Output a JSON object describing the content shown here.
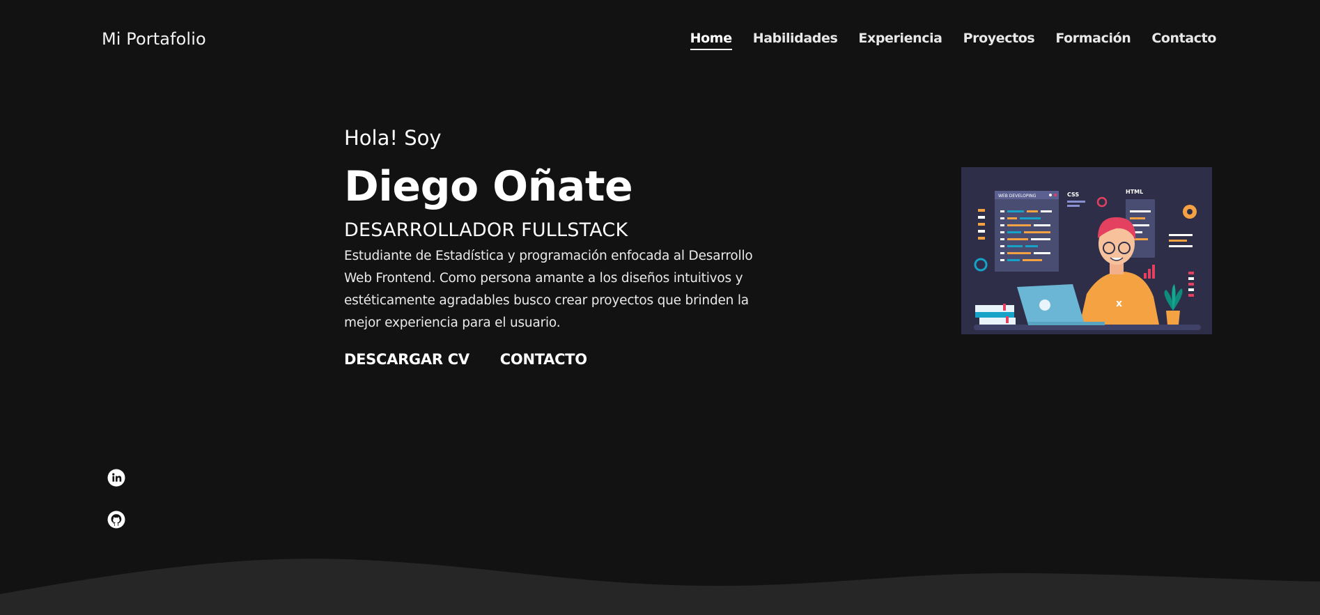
{
  "header": {
    "brand": "Mi Portafolio",
    "nav": [
      {
        "label": "Home",
        "active": true
      },
      {
        "label": "Habilidades"
      },
      {
        "label": "Experiencia"
      },
      {
        "label": "Proyectos"
      },
      {
        "label": "Formación"
      },
      {
        "label": "Contacto"
      }
    ]
  },
  "hero": {
    "greeting": "Hola! Soy",
    "name": "Diego Oñate",
    "role": "DESARROLLADOR FULLSTACK",
    "bio": "Estudiante de Estadística y programación enfocada al Desarrollo Web Frontend. Como persona amante a los diseños intuitivos y estéticamente agradables busco crear proyectos que brinden la mejor experiencia para el usuario.",
    "cta_cv": "DESCARGAR CV",
    "cta_contact": "CONTACTO"
  },
  "illustration": {
    "panel_title": "WEB DEVELOPING",
    "label_css": "CSS",
    "label_html": "HTML"
  },
  "social": [
    {
      "icon": "linkedin-icon"
    },
    {
      "icon": "github-icon"
    }
  ],
  "colors": {
    "background": "#121212",
    "wave": "#262626",
    "text": "#ffffff"
  }
}
